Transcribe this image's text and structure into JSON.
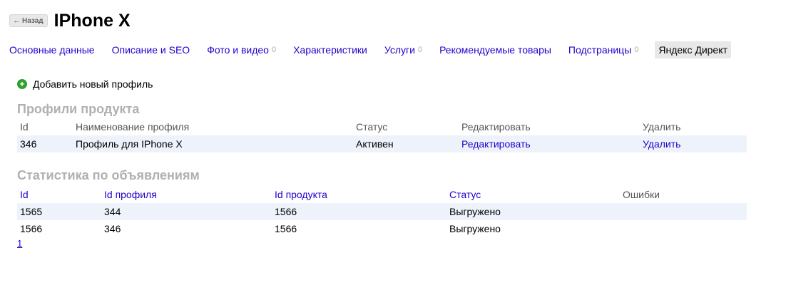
{
  "header": {
    "back_label": "Назад",
    "back_arrow": "←",
    "title": "IPhone X"
  },
  "tabs": [
    {
      "label": "Основные данные",
      "count": ""
    },
    {
      "label": "Описание и SEO",
      "count": ""
    },
    {
      "label": "Фото и видео",
      "count": "0"
    },
    {
      "label": "Характеристики",
      "count": ""
    },
    {
      "label": "Услуги",
      "count": "0"
    },
    {
      "label": "Рекомендуемые товары",
      "count": ""
    },
    {
      "label": "Подстраницы",
      "count": "0"
    },
    {
      "label": "Яндекс Директ",
      "count": ""
    }
  ],
  "add_profile": {
    "icon": "plus-circle-icon",
    "icon_glyph": "+",
    "label": "Добавить новый профиль"
  },
  "profiles": {
    "title": "Профили продукта",
    "headers": [
      "Id",
      "Наименование профиля",
      "Статус",
      "Редактировать",
      "Удалить"
    ],
    "rows": [
      {
        "id": "346",
        "name": "Профиль для IPhone X",
        "status": "Активен",
        "edit": "Редактировать",
        "delete": "Удалить"
      }
    ]
  },
  "stats": {
    "title": "Статистика по объявлениям",
    "headers": [
      "Id",
      "Id профиля",
      "Id продукта",
      "Статус",
      "Ошибки"
    ],
    "rows": [
      {
        "id": "1565",
        "profile_id": "344",
        "product_id": "1566",
        "status": "Выгружено",
        "errors": ""
      },
      {
        "id": "1566",
        "profile_id": "346",
        "product_id": "1566",
        "status": "Выгружено",
        "errors": ""
      }
    ]
  },
  "pagination": {
    "page": "1"
  },
  "colors": {
    "link": "#2200cc",
    "section_title": "#b0b0b0",
    "row_shade": "#eef3fb",
    "add_icon": "#2ea12e"
  }
}
